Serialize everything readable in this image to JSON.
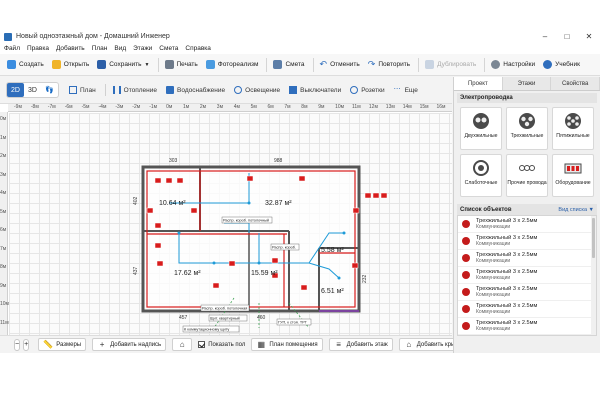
{
  "window": {
    "title": "Новый одноэтажный дом - Домашний Инженер",
    "minimize": "–",
    "maximize": "□",
    "close": "✕"
  },
  "menu": [
    "Файл",
    "Правка",
    "Добавить",
    "План",
    "Вид",
    "Этажи",
    "Смета",
    "Справка"
  ],
  "toolbar": {
    "create": "Создать",
    "open": "Открыть",
    "save": "Сохранить",
    "save_arrow": "▼",
    "print": "Печать",
    "photoreal": "Фотореализм",
    "estimate": "Смета",
    "undo": "Отменить",
    "redo": "Повторить",
    "duplicate": "Дублировать",
    "settings": "Настройки",
    "tutorial": "Учебник"
  },
  "view_modes": [
    "2D",
    "3D",
    "👣"
  ],
  "layers": [
    "План",
    "Отопление",
    "Водоснабжение",
    "Освещение",
    "Выключатели",
    "Розетки",
    "Еще"
  ],
  "ruler": {
    "top": [
      "-9м",
      "-8м",
      "-7м",
      "-6м",
      "-5м",
      "-4м",
      "-3м",
      "-2м",
      "-1м",
      "0м",
      "1м",
      "2м",
      "3м",
      "4м",
      "5м",
      "6м",
      "7м",
      "8м",
      "9м",
      "10м",
      "11м",
      "12м",
      "13м",
      "14м",
      "15м",
      "16м"
    ],
    "left": [
      "0м",
      "1м",
      "2м",
      "3м",
      "4м",
      "5м",
      "6м",
      "7м",
      "8м",
      "9м",
      "10м",
      "11м"
    ]
  },
  "plan": {
    "dim_top_left": "303",
    "dim_top_right": "988",
    "dim_left_top": "402",
    "dim_left_bottom": "437",
    "dim_bottom_left": "457",
    "dim_bottom_right": "460",
    "dim_right_mid": "232",
    "room1_area": "10.64 м²",
    "room2_area": "32.87 м²",
    "room3_area": "17.62 м²",
    "room4_area": "15.59 м²",
    "room5_area": "5.58 м²",
    "room6_area": "6.51 м²",
    "tag_1": "Распр. короб. потолочная",
    "tag_2": "Распр. короб.",
    "tag_3": "Распр. короб. потолочный",
    "tag_4": "Щит. квартирный",
    "tag_5": "К ввод. автомату",
    "tag_6": "ГУП, к стоя. ТРГ",
    "tag_7": "К коммутационному щиту"
  },
  "bottom": {
    "zoom_out": "−",
    "zoom_in": "+",
    "sizes": "Размеры",
    "add_label": "Добавить надпись",
    "home": "⌂",
    "show_floor": "Показать пол",
    "floor_plan": "План помещения",
    "add_floor": "Добавить этаж",
    "add_roof": "Добавить крышу"
  },
  "panel": {
    "tabs": [
      "Проект",
      "Этажи",
      "Свойства"
    ],
    "section_title": "Электропроводка",
    "wires": [
      "Двухжильные",
      "Трехжильные",
      "Пятижильные",
      "Слаботочные",
      "Прочие провода",
      "Оборудование"
    ],
    "objects_title": "Список объектов",
    "objects_view": "Вид списка ▼",
    "objects": [
      {
        "name": "Трехжильный 3 x 2.5мм",
        "category": "Коммуникации"
      },
      {
        "name": "Трехжильный 3 x 2.5мм",
        "category": "Коммуникации"
      },
      {
        "name": "Трехжильный 3 x 2.5мм",
        "category": "Коммуникации"
      },
      {
        "name": "Трехжильный 3 x 2.5мм",
        "category": "Коммуникации"
      },
      {
        "name": "Трехжильный 3 x 2.5мм",
        "category": "Коммуникации"
      },
      {
        "name": "Трехжильный 3 x 2.5мм",
        "category": "Коммуникации"
      },
      {
        "name": "Трехжильный 3 x 2.5мм",
        "category": "Коммуникации"
      }
    ]
  },
  "colors": {
    "accent": "#2f6ebd",
    "wire_red": "#d81c1c",
    "wire_blue": "#1e9bd8",
    "wall": "#555555"
  }
}
